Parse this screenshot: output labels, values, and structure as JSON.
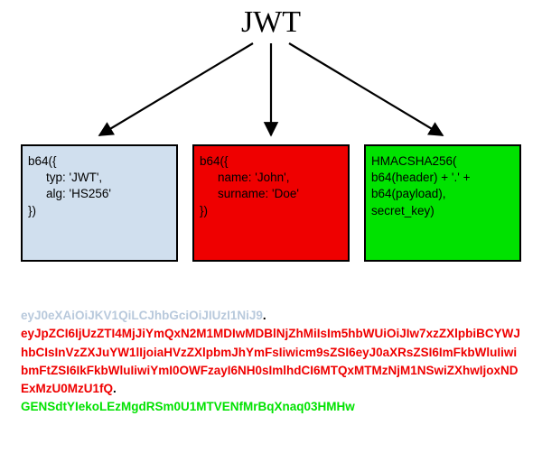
{
  "title": "JWT",
  "colors": {
    "header_box": "#d0dfee",
    "payload_box": "#ef0000",
    "signature_box": "#00e200"
  },
  "header_box": {
    "l1": "b64({",
    "l2": "typ: 'JWT',",
    "l3": "alg: 'HS256'",
    "l4": "})"
  },
  "payload_box": {
    "l1": "b64({",
    "l2": "name: 'John',",
    "l3": "surname: 'Doe'",
    "l4": "})"
  },
  "signature_box": {
    "l1": "HMACSHA256(",
    "l2": "b64(header) + '.' +",
    "l3": "b64(payload),",
    "l4": "secret_key)"
  },
  "token": {
    "header": "eyJ0eXAiOiJKV1QiLCJhbGciOiJIUzI1NiJ9",
    "dot1": ".",
    "payload": "eyJpZCI6IjUzZTI4MjJiYmQxN2M1MDIwMDBlNjZhMiIsIm5hbWUiOiJIw7xzZXlpbiBCYWJhbCIsInVzZXJuYW1lIjoiaHVzZXlpbmJhYmFsIiwicm9sZSI6eyJ0aXRsZSI6ImFkbWluIiwibmFtZSI6IkFkbWluIiwiYmI0OWFzayI6NH0sImlhdCI6MTQxMTMzNjM1NSwiZXhwIjoxNDExMzU0MzU1fQ",
    "dot2": ".",
    "sig": "GENSdtYIekoLEzMgdRSm0U1MTVENfMrBqXnaq03HMHw"
  }
}
